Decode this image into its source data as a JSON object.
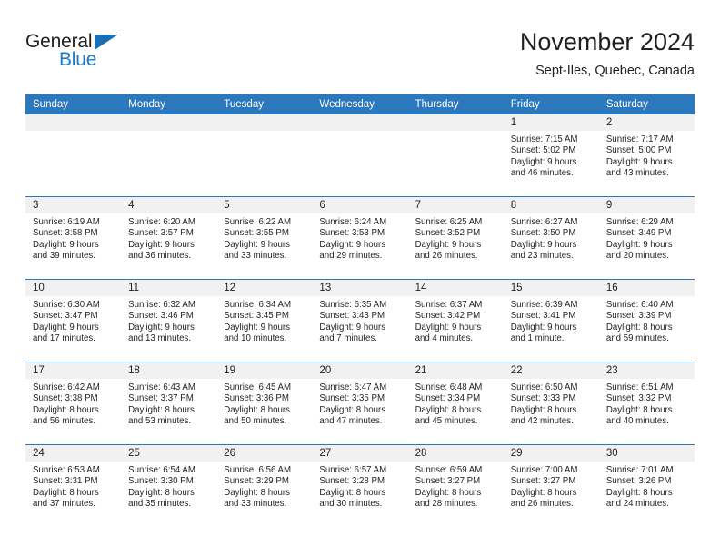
{
  "logo": {
    "word_one": "General",
    "word_two": "Blue",
    "triangle_icon": "blue-triangle-icon",
    "brand_blue": "#1a7ac4",
    "brand_dark": "#231f20"
  },
  "header": {
    "title": "November 2024",
    "subtitle": "Sept-Iles, Quebec, Canada"
  },
  "theme": {
    "header_blue": "#2b78bd",
    "daynum_band": "#f1f1f1",
    "text": "#231f20"
  },
  "weekday_headers": [
    "Sunday",
    "Monday",
    "Tuesday",
    "Wednesday",
    "Thursday",
    "Friday",
    "Saturday"
  ],
  "labels": {
    "sunrise": "Sunrise:",
    "sunset": "Sunset:",
    "daylight": "Daylight:"
  },
  "weeks": [
    [
      {
        "day": "",
        "empty": true
      },
      {
        "day": "",
        "empty": true
      },
      {
        "day": "",
        "empty": true
      },
      {
        "day": "",
        "empty": true
      },
      {
        "day": "",
        "empty": true
      },
      {
        "day": "1",
        "sunrise": "Sunrise: 7:15 AM",
        "sunset": "Sunset: 5:02 PM",
        "daylight_l1": "Daylight: 9 hours",
        "daylight_l2": "and 46 minutes."
      },
      {
        "day": "2",
        "sunrise": "Sunrise: 7:17 AM",
        "sunset": "Sunset: 5:00 PM",
        "daylight_l1": "Daylight: 9 hours",
        "daylight_l2": "and 43 minutes."
      }
    ],
    [
      {
        "day": "3",
        "sunrise": "Sunrise: 6:19 AM",
        "sunset": "Sunset: 3:58 PM",
        "daylight_l1": "Daylight: 9 hours",
        "daylight_l2": "and 39 minutes."
      },
      {
        "day": "4",
        "sunrise": "Sunrise: 6:20 AM",
        "sunset": "Sunset: 3:57 PM",
        "daylight_l1": "Daylight: 9 hours",
        "daylight_l2": "and 36 minutes."
      },
      {
        "day": "5",
        "sunrise": "Sunrise: 6:22 AM",
        "sunset": "Sunset: 3:55 PM",
        "daylight_l1": "Daylight: 9 hours",
        "daylight_l2": "and 33 minutes."
      },
      {
        "day": "6",
        "sunrise": "Sunrise: 6:24 AM",
        "sunset": "Sunset: 3:53 PM",
        "daylight_l1": "Daylight: 9 hours",
        "daylight_l2": "and 29 minutes."
      },
      {
        "day": "7",
        "sunrise": "Sunrise: 6:25 AM",
        "sunset": "Sunset: 3:52 PM",
        "daylight_l1": "Daylight: 9 hours",
        "daylight_l2": "and 26 minutes."
      },
      {
        "day": "8",
        "sunrise": "Sunrise: 6:27 AM",
        "sunset": "Sunset: 3:50 PM",
        "daylight_l1": "Daylight: 9 hours",
        "daylight_l2": "and 23 minutes."
      },
      {
        "day": "9",
        "sunrise": "Sunrise: 6:29 AM",
        "sunset": "Sunset: 3:49 PM",
        "daylight_l1": "Daylight: 9 hours",
        "daylight_l2": "and 20 minutes."
      }
    ],
    [
      {
        "day": "10",
        "sunrise": "Sunrise: 6:30 AM",
        "sunset": "Sunset: 3:47 PM",
        "daylight_l1": "Daylight: 9 hours",
        "daylight_l2": "and 17 minutes."
      },
      {
        "day": "11",
        "sunrise": "Sunrise: 6:32 AM",
        "sunset": "Sunset: 3:46 PM",
        "daylight_l1": "Daylight: 9 hours",
        "daylight_l2": "and 13 minutes."
      },
      {
        "day": "12",
        "sunrise": "Sunrise: 6:34 AM",
        "sunset": "Sunset: 3:45 PM",
        "daylight_l1": "Daylight: 9 hours",
        "daylight_l2": "and 10 minutes."
      },
      {
        "day": "13",
        "sunrise": "Sunrise: 6:35 AM",
        "sunset": "Sunset: 3:43 PM",
        "daylight_l1": "Daylight: 9 hours",
        "daylight_l2": "and 7 minutes."
      },
      {
        "day": "14",
        "sunrise": "Sunrise: 6:37 AM",
        "sunset": "Sunset: 3:42 PM",
        "daylight_l1": "Daylight: 9 hours",
        "daylight_l2": "and 4 minutes."
      },
      {
        "day": "15",
        "sunrise": "Sunrise: 6:39 AM",
        "sunset": "Sunset: 3:41 PM",
        "daylight_l1": "Daylight: 9 hours",
        "daylight_l2": "and 1 minute."
      },
      {
        "day": "16",
        "sunrise": "Sunrise: 6:40 AM",
        "sunset": "Sunset: 3:39 PM",
        "daylight_l1": "Daylight: 8 hours",
        "daylight_l2": "and 59 minutes."
      }
    ],
    [
      {
        "day": "17",
        "sunrise": "Sunrise: 6:42 AM",
        "sunset": "Sunset: 3:38 PM",
        "daylight_l1": "Daylight: 8 hours",
        "daylight_l2": "and 56 minutes."
      },
      {
        "day": "18",
        "sunrise": "Sunrise: 6:43 AM",
        "sunset": "Sunset: 3:37 PM",
        "daylight_l1": "Daylight: 8 hours",
        "daylight_l2": "and 53 minutes."
      },
      {
        "day": "19",
        "sunrise": "Sunrise: 6:45 AM",
        "sunset": "Sunset: 3:36 PM",
        "daylight_l1": "Daylight: 8 hours",
        "daylight_l2": "and 50 minutes."
      },
      {
        "day": "20",
        "sunrise": "Sunrise: 6:47 AM",
        "sunset": "Sunset: 3:35 PM",
        "daylight_l1": "Daylight: 8 hours",
        "daylight_l2": "and 47 minutes."
      },
      {
        "day": "21",
        "sunrise": "Sunrise: 6:48 AM",
        "sunset": "Sunset: 3:34 PM",
        "daylight_l1": "Daylight: 8 hours",
        "daylight_l2": "and 45 minutes."
      },
      {
        "day": "22",
        "sunrise": "Sunrise: 6:50 AM",
        "sunset": "Sunset: 3:33 PM",
        "daylight_l1": "Daylight: 8 hours",
        "daylight_l2": "and 42 minutes."
      },
      {
        "day": "23",
        "sunrise": "Sunrise: 6:51 AM",
        "sunset": "Sunset: 3:32 PM",
        "daylight_l1": "Daylight: 8 hours",
        "daylight_l2": "and 40 minutes."
      }
    ],
    [
      {
        "day": "24",
        "sunrise": "Sunrise: 6:53 AM",
        "sunset": "Sunset: 3:31 PM",
        "daylight_l1": "Daylight: 8 hours",
        "daylight_l2": "and 37 minutes."
      },
      {
        "day": "25",
        "sunrise": "Sunrise: 6:54 AM",
        "sunset": "Sunset: 3:30 PM",
        "daylight_l1": "Daylight: 8 hours",
        "daylight_l2": "and 35 minutes."
      },
      {
        "day": "26",
        "sunrise": "Sunrise: 6:56 AM",
        "sunset": "Sunset: 3:29 PM",
        "daylight_l1": "Daylight: 8 hours",
        "daylight_l2": "and 33 minutes."
      },
      {
        "day": "27",
        "sunrise": "Sunrise: 6:57 AM",
        "sunset": "Sunset: 3:28 PM",
        "daylight_l1": "Daylight: 8 hours",
        "daylight_l2": "and 30 minutes."
      },
      {
        "day": "28",
        "sunrise": "Sunrise: 6:59 AM",
        "sunset": "Sunset: 3:27 PM",
        "daylight_l1": "Daylight: 8 hours",
        "daylight_l2": "and 28 minutes."
      },
      {
        "day": "29",
        "sunrise": "Sunrise: 7:00 AM",
        "sunset": "Sunset: 3:27 PM",
        "daylight_l1": "Daylight: 8 hours",
        "daylight_l2": "and 26 minutes."
      },
      {
        "day": "30",
        "sunrise": "Sunrise: 7:01 AM",
        "sunset": "Sunset: 3:26 PM",
        "daylight_l1": "Daylight: 8 hours",
        "daylight_l2": "and 24 minutes."
      }
    ]
  ]
}
